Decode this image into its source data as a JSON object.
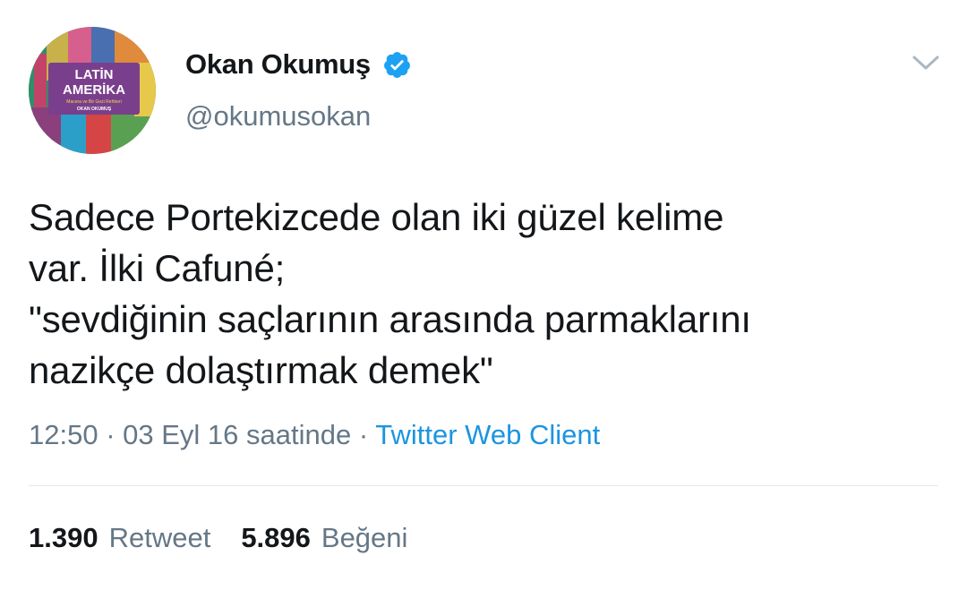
{
  "author": {
    "name": "Okan Okumuş",
    "handle": "@okumusokan",
    "avatar_text": [
      "LATİN",
      "AMERİKA",
      "Macera ve Bir Gezi Rehberi",
      "OKAN OKUMUŞ"
    ]
  },
  "tweet": {
    "text": "Sadece Portekizcede olan iki güzel kelime\nvar. İlki Cafuné;\n\"sevdiğinin saçlarının arasında parmaklarını\nnazikçe dolaştırmak demek\"",
    "time": "12:50",
    "separator": "·",
    "date": "03 Eyl 16 saatinde",
    "client": "Twitter Web Client"
  },
  "stats": {
    "retweet_count": "1.390",
    "retweet_label": "Retweet",
    "like_count": "5.896",
    "like_label": "Beğeni"
  },
  "colors": {
    "text": "#14171a",
    "secondary": "#657786",
    "link": "#1b95e0",
    "verified": "#1da1f2",
    "divider": "#e1e8ed",
    "avatar_label_bg": "#7a3f8c"
  },
  "icons": {
    "verified": "verified-badge-icon",
    "menu": "chevron-down-icon"
  }
}
